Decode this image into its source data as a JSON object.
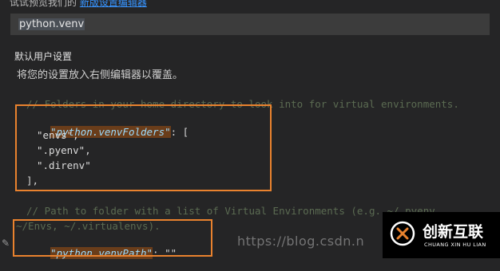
{
  "header": {
    "hint_prefix": "试试预览我们的",
    "hint_link": "新版设置编辑器"
  },
  "search": {
    "value": "python.venv"
  },
  "section": {
    "title": "默认用户设置",
    "description": "将您的设置放入右侧编辑器以覆盖。"
  },
  "code": {
    "comment1": "// Folders in your home directory to look into for virtual environments.",
    "key1": "\"python.venvFolders\"",
    "after_key1": ": [",
    "item1": "\"envs\",",
    "item2": "\".pyenv\",",
    "item3": "\".direnv\"",
    "close1": "],",
    "comment2a": "// Path to folder with a list of Virtual Environments (e.g. ~/.pyenv,",
    "comment2b": "~/Envs, ~/.virtualenvs).",
    "key2": "\"python.venvPath\"",
    "after_key2": ": \"\""
  },
  "watermark": {
    "text": "https://blog.csdn.n"
  },
  "brand": {
    "name": "创新互联",
    "sub": "CHUANG XIN HU LIAN"
  },
  "colors": {
    "accent_box": "#e9822e",
    "background": "#252526",
    "key": "#9cdcfe"
  }
}
